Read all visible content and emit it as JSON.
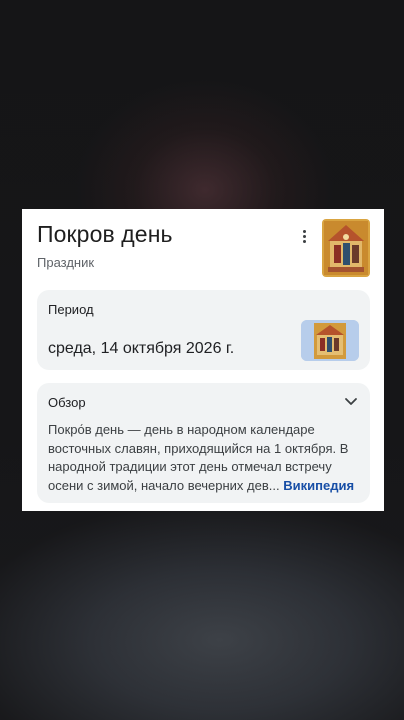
{
  "card": {
    "title": "Покров день",
    "subtitle": "Праздник",
    "more_icon": "more-vert-icon",
    "thumbnail_icon": "icon-painting-thumbnail"
  },
  "period": {
    "label": "Период",
    "value": "среда, 14 октября 2026 г.",
    "thumbnail_icon": "icon-painting-thumbnail"
  },
  "overview": {
    "label": "Обзор",
    "expand_icon": "chevron-down-icon",
    "text": "Покро́в день — день в народном календаре восточных славян, приходящийся на 1 октября. В народной традиции этот день отмечал встречу осени с зимой, начало вечерних дев",
    "ellipsis": "...",
    "source_link": "Википедия"
  },
  "colors": {
    "card_bg": "#ffffff",
    "panel_bg": "#f1f3f4",
    "link": "#174ea6",
    "title_text": "#1f1f1f"
  }
}
